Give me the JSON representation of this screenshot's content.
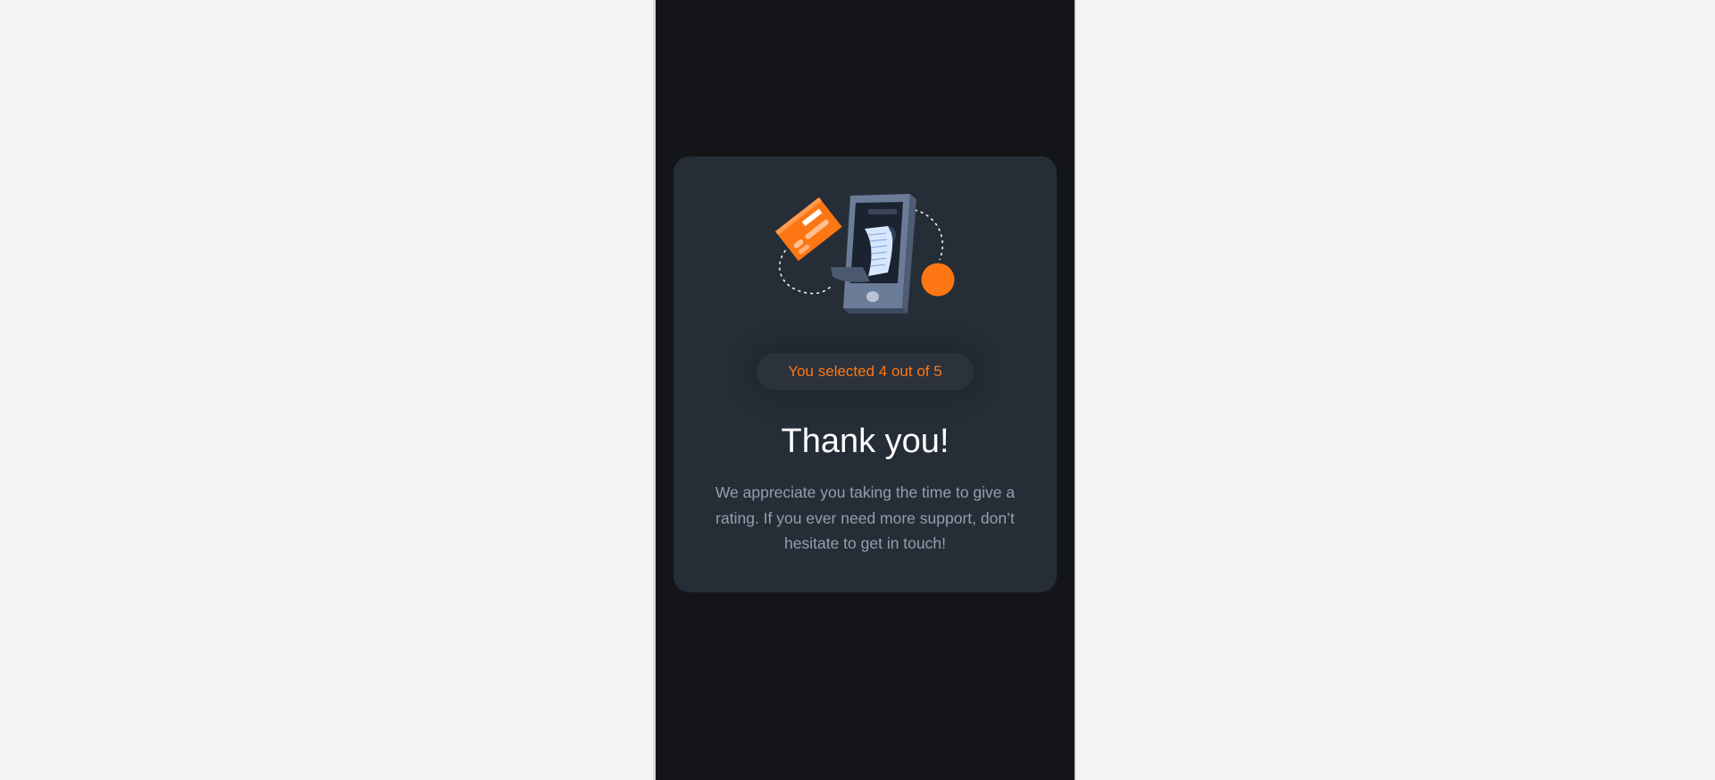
{
  "thank_you": {
    "selection_text": "You selected 4 out of 5",
    "title": "Thank you!",
    "description": "We appreciate you taking the time to give a rating. If you ever need more support, don’t hesitate to get in touch!",
    "illustration_icon": "phone-payment-illustration-icon",
    "rating_selected": 4,
    "rating_max": 5
  },
  "colors": {
    "page_background": "#f4f4f4",
    "stage_background": "#131518",
    "card_background": "#252d37",
    "accent": "#fc7614",
    "heading": "#ffffff",
    "body_text": "#959eac"
  }
}
